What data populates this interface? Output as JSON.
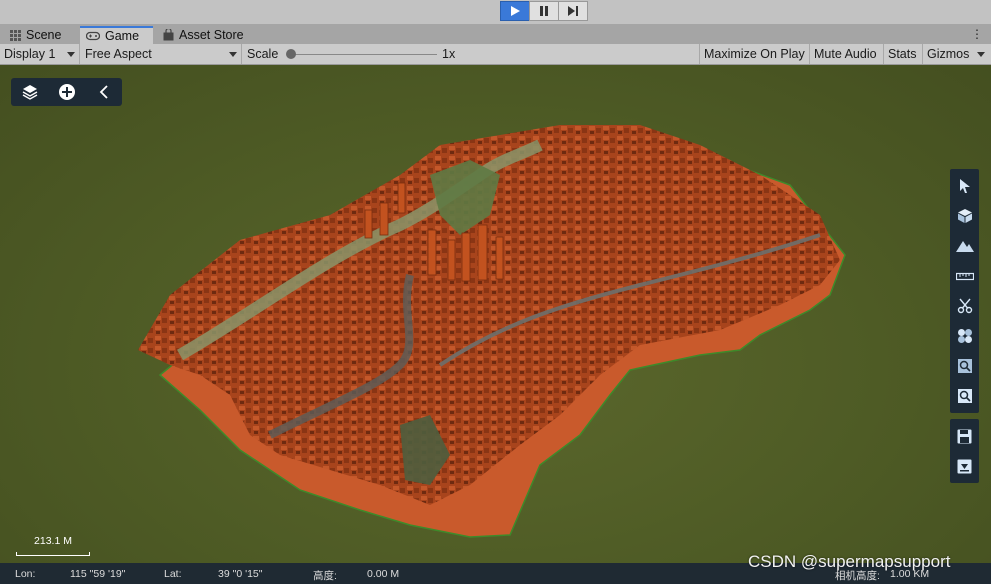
{
  "playbar": {
    "buttons": [
      {
        "name": "play-button",
        "icon": "play-icon",
        "active": true
      },
      {
        "name": "pause-button",
        "icon": "pause-icon",
        "active": false
      },
      {
        "name": "step-button",
        "icon": "step-icon",
        "active": false
      }
    ]
  },
  "tabs": [
    {
      "label": "Scene",
      "icon": "grid-icon",
      "active": false
    },
    {
      "label": "Game",
      "icon": "gamepad-icon",
      "active": true
    },
    {
      "label": "Asset Store",
      "icon": "store-icon",
      "active": false
    }
  ],
  "tab_menu": "⋮",
  "game_toolbar": {
    "display": "Display 1",
    "aspect": "Free Aspect",
    "scale_label": "Scale",
    "scale_value": "1x",
    "maximize": "Maximize On Play",
    "mute": "Mute Audio",
    "stats": "Stats",
    "gizmos": "Gizmos"
  },
  "scale_bar": {
    "text": "213.1  M"
  },
  "status": {
    "lon_label": "Lon:",
    "lon_value": "115 \"59 '19\"",
    "lat_label": "Lat:",
    "lat_value": "39 \"0 '15\"",
    "height_label": "高度:",
    "height_value": "0.00 M",
    "camera_label": "相机高度:",
    "camera_value": "1.00  KM"
  },
  "watermark": "CSDN @supermapsupport",
  "colors": {
    "accent": "#3a79d8",
    "viewport_bg": "#4e5b25",
    "city": "#b84a1e",
    "panel_bg": "#1d2a36"
  }
}
